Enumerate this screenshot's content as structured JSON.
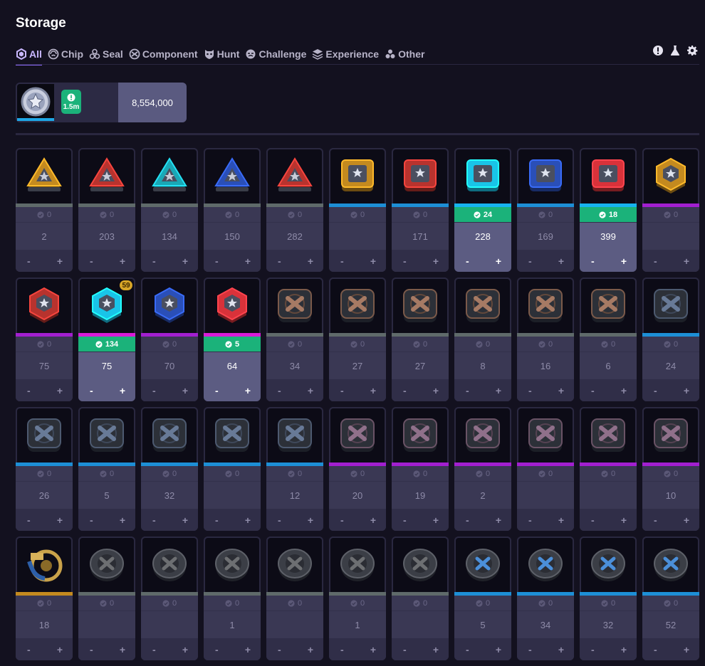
{
  "page": {
    "title": "Storage"
  },
  "tabs": [
    {
      "label": "All",
      "icon": "hexagon-icon",
      "active": true
    },
    {
      "label": "Chip",
      "icon": "chip-icon",
      "active": false
    },
    {
      "label": "Seal",
      "icon": "seal-icon",
      "active": false
    },
    {
      "label": "Component",
      "icon": "component-icon",
      "active": false
    },
    {
      "label": "Hunt",
      "icon": "hunt-icon",
      "active": false
    },
    {
      "label": "Challenge",
      "icon": "challenge-icon",
      "active": false
    },
    {
      "label": "Experience",
      "icon": "experience-icon",
      "active": false
    },
    {
      "label": "Other",
      "icon": "other-icon",
      "active": false
    }
  ],
  "toolbar": {
    "icons": [
      "alert-icon",
      "flask-icon",
      "gear-icon"
    ]
  },
  "currency": {
    "badge": "1.5m",
    "amount": "8,554,000",
    "accent": "#1ea7e6"
  },
  "colors": {
    "green": "#1bb27a",
    "gray": "#5f6a6a",
    "blue": "#1d8fd6",
    "purple": "#a21fd0",
    "cyan": "#16b3f0",
    "magenta": "#d81cd8",
    "gold": "#c48a1f"
  },
  "items": [
    {
      "shape": "tri",
      "color": "#c48a1f",
      "bar": "gray",
      "own": "0",
      "qty": "2",
      "sel": false
    },
    {
      "shape": "tri",
      "color": "#b8332e",
      "bar": "gray",
      "own": "0",
      "qty": "203",
      "sel": false
    },
    {
      "shape": "tri",
      "color": "#1aa7b5",
      "bar": "gray",
      "own": "0",
      "qty": "134",
      "sel": false
    },
    {
      "shape": "tri",
      "color": "#2a4fb8",
      "bar": "gray",
      "own": "0",
      "qty": "150",
      "sel": false
    },
    {
      "shape": "tri",
      "color": "#b8332e",
      "bar": "gray",
      "own": "0",
      "qty": "282",
      "sel": false
    },
    {
      "shape": "sq",
      "color": "#c48a1f",
      "bar": "blue",
      "own": "0",
      "qty": "",
      "sel": false
    },
    {
      "shape": "sq",
      "color": "#b8332e",
      "bar": "blue",
      "own": "0",
      "qty": "171",
      "sel": false
    },
    {
      "shape": "sq",
      "color": "#19c4e8",
      "bar": "cyan",
      "own": "24",
      "qty": "228",
      "sel": true
    },
    {
      "shape": "sq",
      "color": "#2a4fb8",
      "bar": "blue",
      "own": "0",
      "qty": "169",
      "sel": false
    },
    {
      "shape": "sq",
      "color": "#d9323a",
      "bar": "cyan",
      "own": "18",
      "qty": "399",
      "sel": true
    },
    {
      "shape": "hex",
      "color": "#c48a1f",
      "bar": "purple",
      "own": "0",
      "qty": "",
      "sel": false
    },
    {
      "shape": "hex",
      "color": "#b8332e",
      "bar": "purple",
      "own": "0",
      "qty": "75",
      "sel": false
    },
    {
      "shape": "hex",
      "color": "#19c4e8",
      "bar": "magenta",
      "own": "134",
      "qty": "75",
      "sel": true,
      "tier": "59"
    },
    {
      "shape": "hex",
      "color": "#2a4fb8",
      "bar": "purple",
      "own": "0",
      "qty": "70",
      "sel": false
    },
    {
      "shape": "hex",
      "color": "#d9323a",
      "bar": "magenta",
      "own": "5",
      "qty": "64",
      "sel": true
    },
    {
      "shape": "comp",
      "color": "#7b5a4a",
      "bar": "gray",
      "own": "0",
      "qty": "34",
      "sel": false
    },
    {
      "shape": "comp",
      "color": "#7b5a4a",
      "bar": "gray",
      "own": "0",
      "qty": "27",
      "sel": false
    },
    {
      "shape": "comp",
      "color": "#7b5a4a",
      "bar": "gray",
      "own": "0",
      "qty": "27",
      "sel": false
    },
    {
      "shape": "comp",
      "color": "#7b5a4a",
      "bar": "gray",
      "own": "0",
      "qty": "8",
      "sel": false
    },
    {
      "shape": "comp",
      "color": "#7b5a4a",
      "bar": "gray",
      "own": "0",
      "qty": "16",
      "sel": false
    },
    {
      "shape": "comp",
      "color": "#7b5a4a",
      "bar": "gray",
      "own": "0",
      "qty": "6",
      "sel": false
    },
    {
      "shape": "comp",
      "color": "#4d5a70",
      "bar": "blue",
      "own": "0",
      "qty": "24",
      "sel": false
    },
    {
      "shape": "comp",
      "color": "#4d5a70",
      "bar": "blue",
      "own": "0",
      "qty": "26",
      "sel": false
    },
    {
      "shape": "comp",
      "color": "#4d5a70",
      "bar": "blue",
      "own": "0",
      "qty": "5",
      "sel": false
    },
    {
      "shape": "comp",
      "color": "#4d5a70",
      "bar": "blue",
      "own": "0",
      "qty": "32",
      "sel": false
    },
    {
      "shape": "comp",
      "color": "#4d5a70",
      "bar": "blue",
      "own": "0",
      "qty": "",
      "sel": false
    },
    {
      "shape": "comp",
      "color": "#4d5a70",
      "bar": "blue",
      "own": "0",
      "qty": "12",
      "sel": false
    },
    {
      "shape": "comp",
      "color": "#6a5366",
      "bar": "purple",
      "own": "0",
      "qty": "20",
      "sel": false
    },
    {
      "shape": "comp",
      "color": "#6a5366",
      "bar": "purple",
      "own": "0",
      "qty": "19",
      "sel": false
    },
    {
      "shape": "comp",
      "color": "#6a5366",
      "bar": "purple",
      "own": "0",
      "qty": "2",
      "sel": false
    },
    {
      "shape": "comp",
      "color": "#6a5366",
      "bar": "purple",
      "own": "0",
      "qty": "",
      "sel": false
    },
    {
      "shape": "comp",
      "color": "#6a5366",
      "bar": "purple",
      "own": "0",
      "qty": "",
      "sel": false
    },
    {
      "shape": "comp",
      "color": "#6a5366",
      "bar": "purple",
      "own": "0",
      "qty": "10",
      "sel": false
    },
    {
      "shape": "gold",
      "color": "#c48a1f",
      "bar": "gold",
      "own": "0",
      "qty": "18",
      "sel": false
    },
    {
      "shape": "disc",
      "color": "#6d6f72",
      "bar": "gray",
      "own": "0",
      "qty": "",
      "sel": false
    },
    {
      "shape": "disc",
      "color": "#6d6f72",
      "bar": "gray",
      "own": "0",
      "qty": "",
      "sel": false
    },
    {
      "shape": "disc",
      "color": "#6d6f72",
      "bar": "gray",
      "own": "0",
      "qty": "1",
      "sel": false
    },
    {
      "shape": "disc",
      "color": "#6d6f72",
      "bar": "gray",
      "own": "0",
      "qty": "",
      "sel": false
    },
    {
      "shape": "disc",
      "color": "#6d6f72",
      "bar": "gray",
      "own": "0",
      "qty": "1",
      "sel": false
    },
    {
      "shape": "disc",
      "color": "#6d6f72",
      "bar": "gray",
      "own": "0",
      "qty": "",
      "sel": false
    },
    {
      "shape": "disc",
      "color": "#4b8fd9",
      "bar": "blue",
      "own": "0",
      "qty": "5",
      "sel": false
    },
    {
      "shape": "disc",
      "color": "#4b8fd9",
      "bar": "blue",
      "own": "0",
      "qty": "34",
      "sel": false
    },
    {
      "shape": "disc",
      "color": "#4b8fd9",
      "bar": "blue",
      "own": "0",
      "qty": "32",
      "sel": false
    },
    {
      "shape": "disc",
      "color": "#4b8fd9",
      "bar": "blue",
      "own": "0",
      "qty": "52",
      "sel": false
    }
  ],
  "controls": {
    "minus": "-",
    "plus": "+"
  }
}
